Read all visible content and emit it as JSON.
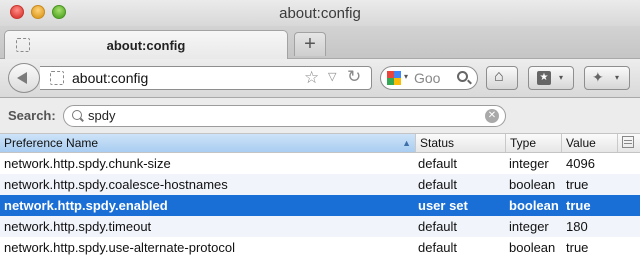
{
  "window": {
    "title": "about:config"
  },
  "tabs": [
    {
      "label": "about:config"
    }
  ],
  "new_tab_label": "+",
  "navbar": {
    "url": "about:config",
    "search_engine_text": "Goo"
  },
  "icons": {
    "star": "☆",
    "dropdown": "▽",
    "reload": "↻",
    "home": "⌂",
    "arrow": "▾",
    "bookmarks": "★",
    "extension": "✦",
    "clear": "✕",
    "sort": "▲"
  },
  "search": {
    "label": "Search:",
    "value": "spdy"
  },
  "table": {
    "columns": [
      "Preference Name",
      "Status",
      "Type",
      "Value"
    ],
    "rows": [
      {
        "name": "network.http.spdy.chunk-size",
        "status": "default",
        "type": "integer",
        "value": "4096"
      },
      {
        "name": "network.http.spdy.coalesce-hostnames",
        "status": "default",
        "type": "boolean",
        "value": "true"
      },
      {
        "name": "network.http.spdy.enabled",
        "status": "user set",
        "type": "boolean",
        "value": "true"
      },
      {
        "name": "network.http.spdy.timeout",
        "status": "default",
        "type": "integer",
        "value": "180"
      },
      {
        "name": "network.http.spdy.use-alternate-protocol",
        "status": "default",
        "type": "boolean",
        "value": "true"
      }
    ]
  },
  "colors": {
    "selection": "#1a6fd6",
    "sorted_header": "#a9cdf1"
  }
}
